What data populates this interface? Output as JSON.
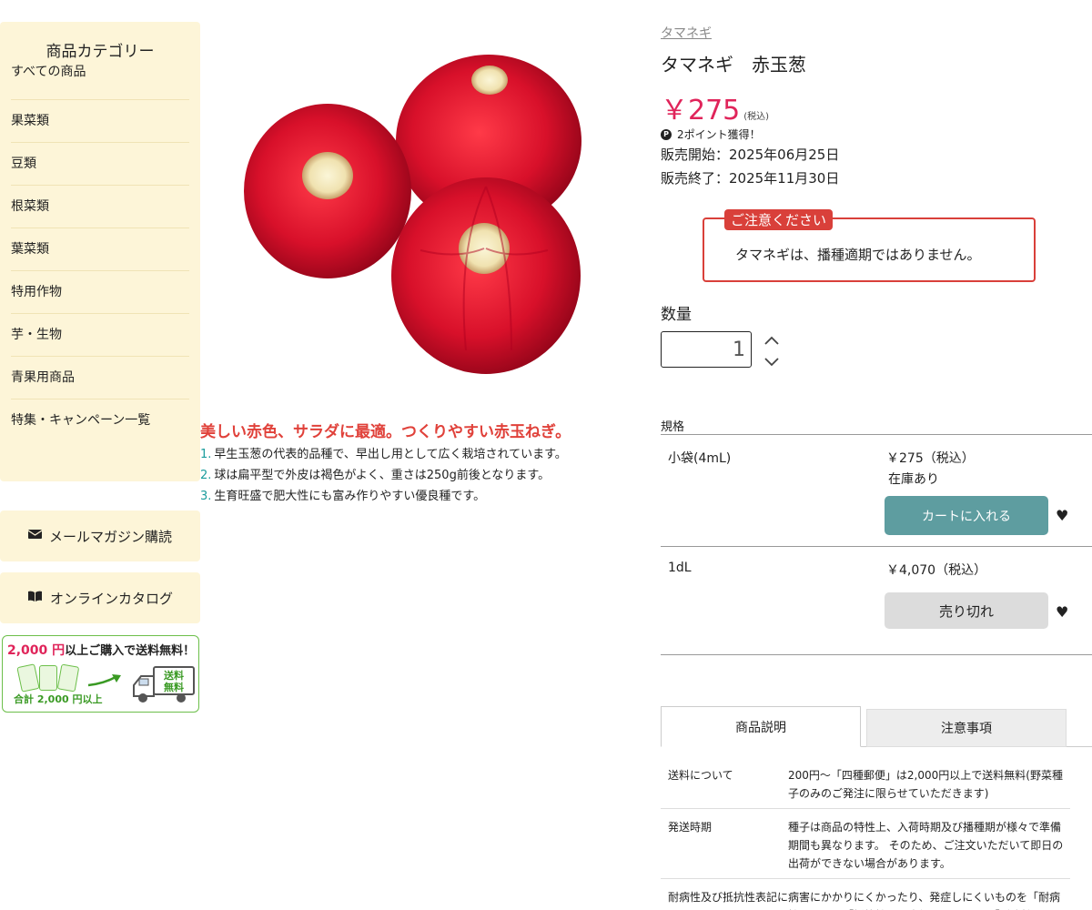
{
  "sidebar": {
    "title": "商品カテゴリー",
    "items": [
      {
        "label": "すべての商品"
      },
      {
        "label": "果菜類"
      },
      {
        "label": "豆類"
      },
      {
        "label": "根菜類"
      },
      {
        "label": "葉菜類"
      },
      {
        "label": "特用作物"
      },
      {
        "label": "芋・生物"
      },
      {
        "label": "青果用商品"
      },
      {
        "label": "特集・キャンペーン一覧"
      }
    ],
    "newsletter_label": "メールマガジン購読",
    "catalog_label": "オンラインカタログ",
    "promo": {
      "amount": "2,000 円",
      "text": "以上ご購入で送料無料！",
      "sub": "合計 2,000 円以上",
      "truck_line1": "送料",
      "truck_line2": "無料"
    }
  },
  "product": {
    "breadcrumb": "タマネギ",
    "title": "タマネギ　赤玉葱",
    "price": "￥275",
    "tax_note": "(税込)",
    "points_badge": "P",
    "points_text": "2ポイント獲得！",
    "sale_start": "販売開始：2025年06月25日",
    "sale_end": "販売終了：2025年11月30日",
    "notice_label": "ご注意ください",
    "notice_text": "タマネギは、播種適期ではありません。",
    "quantity_label": "数量",
    "quantity_value": "1",
    "tagline": "美しい赤色、サラダに最適。つくりやすい赤玉ねぎ。",
    "features": [
      {
        "num": "1.",
        "text": "早生玉葱の代表的品種で、早出し用として広く栽培されています。"
      },
      {
        "num": "2.",
        "text": "球は扁平型で外皮は褐色がよく、重さは250g前後となります。"
      },
      {
        "num": "3.",
        "text": "生育旺盛で肥大性にも富み作りやすい優良種です。"
      }
    ]
  },
  "spec": {
    "label": "規格",
    "variants": [
      {
        "name": "小袋(4mL)",
        "price": "￥275（税込）",
        "stock": "在庫あり",
        "button": "カートに入れる"
      },
      {
        "name": "1dL",
        "price": "￥4,070（税込）",
        "stock": "",
        "button": "売り切れ"
      }
    ]
  },
  "tabs": [
    {
      "label": "商品説明"
    },
    {
      "label": "注意事項"
    }
  ],
  "info": [
    {
      "key": "送料について",
      "value": "200円〜「四種郵便」は2,000円以上で送料無料(野菜種子のみのご発注に限らせていただきます)"
    },
    {
      "key": "発送時期",
      "value": "種子は商品の特性上、入荷時期及び播種期が様々で準備期間も異なります。 そのため、ご注文いただいて即日の出荷ができない場合があります。"
    },
    {
      "key": "耐病性及び抵抗性表記について",
      "value": "病害にかかりにくかったり、発症しにくいものを「耐病性」または「抵抗性」と表記しています。「耐病性」"
    }
  ],
  "colors": {
    "price": "#e0245a",
    "accent_red": "#d9403a",
    "cart_button": "#5e9da0",
    "sidebar_bg": "#fdf5d8",
    "feature_number": "#1a9c9c"
  }
}
